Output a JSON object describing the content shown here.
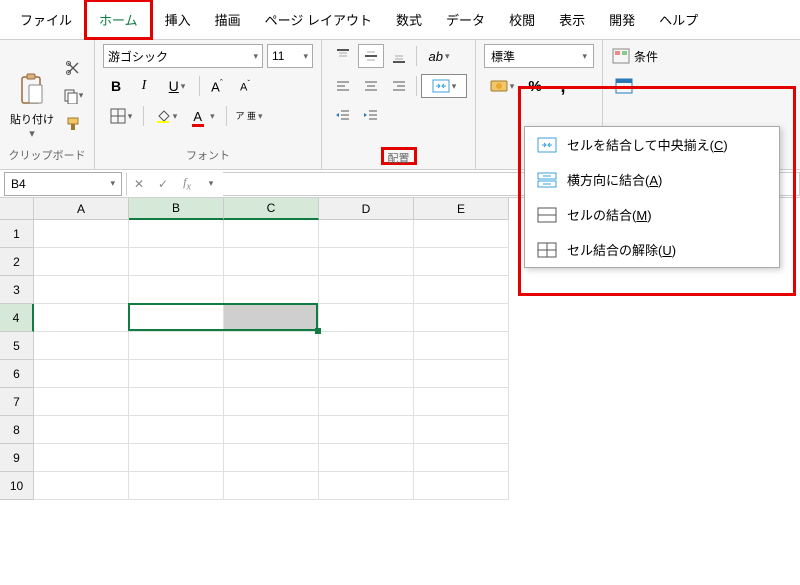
{
  "tabs": {
    "file": "ファイル",
    "home": "ホーム",
    "insert": "挿入",
    "draw": "描画",
    "pagelayout": "ページ レイアウト",
    "formulas": "数式",
    "data": "データ",
    "review": "校閲",
    "view": "表示",
    "developer": "開発",
    "help": "ヘルプ"
  },
  "ribbon": {
    "clipboard": {
      "paste": "貼り付け",
      "label": "クリップボード"
    },
    "font": {
      "name": "游ゴシック",
      "size": "11",
      "label": "フォント",
      "ruby": "ア\n亜"
    },
    "align": {
      "label": "配置"
    },
    "number": {
      "format": "標準"
    },
    "styles": {
      "cond": "条件"
    }
  },
  "merge_menu": {
    "merge_center": "セルを結合して中央揃え(",
    "merge_center_k": "C",
    "merge_across": "横方向に結合(",
    "merge_across_k": "A",
    "merge_cells": "セルの結合(",
    "merge_cells_k": "M",
    "unmerge": "セル結合の解除(",
    "unmerge_k": "U",
    "close": ")"
  },
  "namebox": "B4",
  "columns": [
    "A",
    "B",
    "C",
    "D",
    "E"
  ],
  "row_count": 10,
  "selected_row": 4,
  "selected_cols": [
    "B",
    "C"
  ]
}
